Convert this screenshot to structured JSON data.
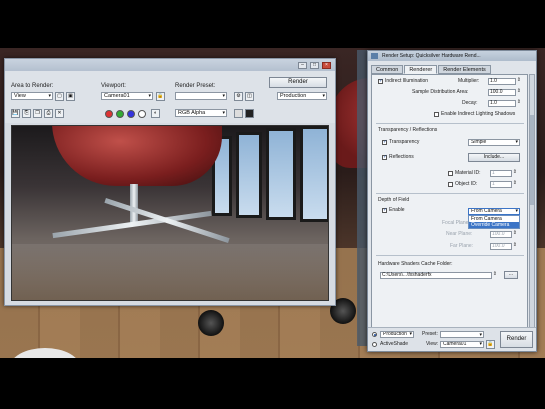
{
  "frame_window": {
    "area_to_render_label": "Area to Render:",
    "area_to_render_value": "View",
    "viewport_label": "Viewport:",
    "viewport_value": "Camera01",
    "render_preset_label": "Render Preset:",
    "render_preset_value": "",
    "render_button": "Render",
    "production_value": "Production",
    "channel_value": "RGB Alpha"
  },
  "setup": {
    "title": "Render Setup: Quicksilver Hardware Rend...",
    "tabs": [
      "Common",
      "Renderer",
      "Render Elements"
    ],
    "active_tab": 1,
    "indirect_illumination_label": "Indirect Illumination",
    "multiplier_label": "Multiplier:",
    "multiplier_value": "1.0",
    "sample_distribution_label": "Sample Distribution Area:",
    "sample_distribution_value": "100.0",
    "decay_label": "Decay:",
    "decay_value": "1.0",
    "enable_indirect_shadows_label": "Enable Indirect Lighting Shadows",
    "transparency_section": "Transparency / Reflections",
    "transparency_label": "Transparency",
    "transparency_value": "Simple",
    "reflections_label": "Reflections",
    "include_button": "Include...",
    "material_id_label": "Material ID:",
    "object_id_label": "Object ID:",
    "id_value": "1",
    "dof_section": "Depth of Field",
    "dof_enable_label": "Enable",
    "dof_mode_value": "From Camera",
    "dof_options": [
      "From Camera",
      "Override Camera"
    ],
    "focal_plane_label": "Focal Plane:",
    "near_plane_label": "Near Plane:",
    "far_plane_label": "Far Plane:",
    "focal_value": "100.0",
    "near_value": "100.0",
    "far_value": "100.0",
    "cache_folder_label": "Hardware Shaders Cache Folder:",
    "cache_folder_value": "C:\\Users\\...\\fxshaderfx",
    "browse_button": "...",
    "footer_production_label": "Production",
    "footer_activeshade_label": "ActiveShade",
    "footer_preset_label": "Preset:",
    "footer_preset_value": "",
    "footer_view_label": "View:",
    "footer_view_value": "Camera01",
    "footer_render_button": "Render"
  },
  "colors": {
    "dialog_bg": "#dfe4ea",
    "title_bar": "#b4c0cf",
    "selection": "#3b74c6",
    "chair_red": "#8a2424"
  }
}
